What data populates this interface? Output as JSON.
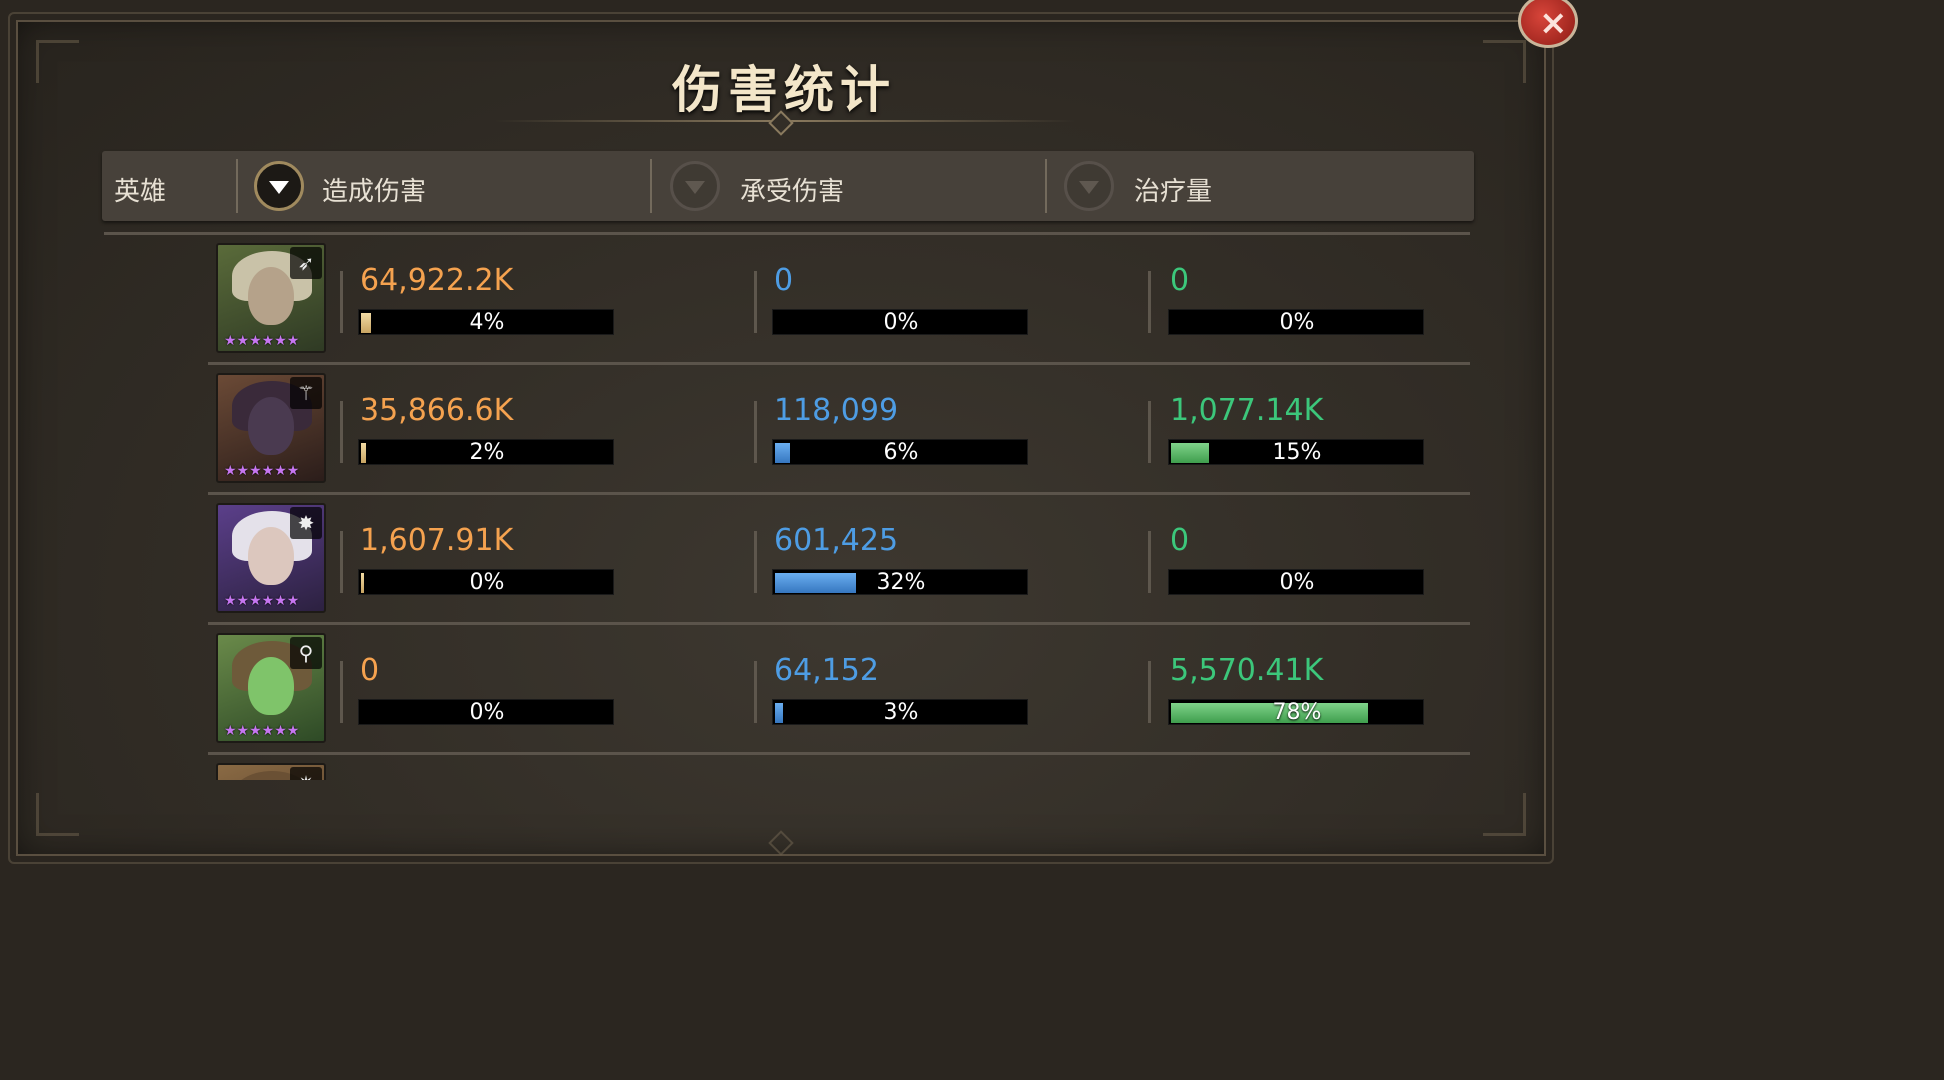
{
  "title": "伤害统计",
  "close_icon": "×",
  "header": {
    "hero_label": "英雄",
    "columns": [
      {
        "label": "造成伤害",
        "sort_active": true
      },
      {
        "label": "承受伤害",
        "sort_active": false
      },
      {
        "label": "治疗量",
        "sort_active": false
      }
    ]
  },
  "colors": {
    "damage_dealt": "#f5a24f",
    "damage_taken": "#4e9de4",
    "healing": "#3cc77b",
    "stars": "#c676f0"
  },
  "heroes": [
    {
      "portrait_icon": "elf-druid-portrait",
      "class_icon": "bow-icon",
      "class_glyph": "➶",
      "stars": "★★★★★★",
      "dealt": {
        "value": "64,922.2K",
        "pct": "4%",
        "ratio": 0.04
      },
      "taken": {
        "value": "0",
        "pct": "0%",
        "ratio": 0
      },
      "heal": {
        "value": "0",
        "pct": "0%",
        "ratio": 0
      }
    },
    {
      "portrait_icon": "dragon-rose-portrait",
      "class_icon": "staff-icon",
      "class_glyph": "⚚",
      "stars": "★★★★★★",
      "dealt": {
        "value": "35,866.6K",
        "pct": "2%",
        "ratio": 0.02
      },
      "taken": {
        "value": "118,099",
        "pct": "6%",
        "ratio": 0.06
      },
      "heal": {
        "value": "1,077.14K",
        "pct": "15%",
        "ratio": 0.15
      }
    },
    {
      "portrait_icon": "white-hair-mage-portrait",
      "class_icon": "wand-icon",
      "class_glyph": "✸",
      "stars": "★★★★★★",
      "dealt": {
        "value": "1,607.91K",
        "pct": "0%",
        "ratio": 0.006
      },
      "taken": {
        "value": "601,425",
        "pct": "32%",
        "ratio": 0.32
      },
      "heal": {
        "value": "0",
        "pct": "0%",
        "ratio": 0
      }
    },
    {
      "portrait_icon": "green-horned-priestess-portrait",
      "class_icon": "praying-hands-icon",
      "class_glyph": "⚲",
      "stars": "★★★★★★",
      "dealt": {
        "value": "0",
        "pct": "0%",
        "ratio": 0
      },
      "taken": {
        "value": "64,152",
        "pct": "3%",
        "ratio": 0.03
      },
      "heal": {
        "value": "5,570.41K",
        "pct": "78%",
        "ratio": 0.78
      }
    },
    {
      "portrait_icon": "partial-hero-portrait",
      "class_icon": "sun-icon",
      "class_glyph": "✷",
      "stars": "",
      "dealt": {
        "value": "",
        "pct": "",
        "ratio": 0
      },
      "taken": {
        "value": "",
        "pct": "",
        "ratio": 0
      },
      "heal": {
        "value": "",
        "pct": "",
        "ratio": 0
      }
    }
  ]
}
